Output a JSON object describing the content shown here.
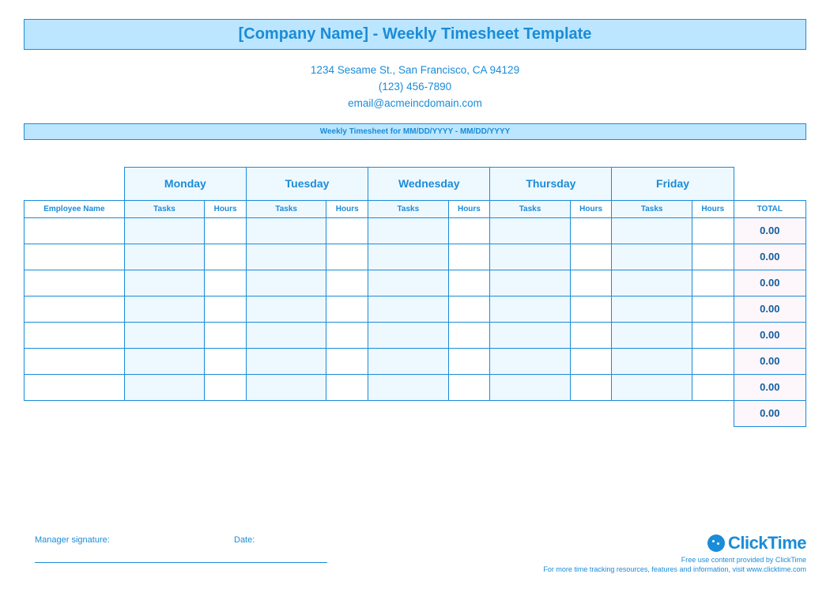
{
  "title": "[Company Name] - Weekly Timesheet Template",
  "company": {
    "address": "1234 Sesame St.,  San Francisco, CA 94129",
    "phone": "(123) 456-7890",
    "email": "email@acmeincdomain.com"
  },
  "week_label": "Weekly Timesheet for MM/DD/YYYY - MM/DD/YYYY",
  "columns": {
    "employee": "Employee Name",
    "days": [
      "Monday",
      "Tuesday",
      "Wednesday",
      "Thursday",
      "Friday"
    ],
    "tasks": "Tasks",
    "hours": "Hours",
    "total": "TOTAL"
  },
  "rows": [
    {
      "name": "",
      "cells": [
        "",
        "",
        "",
        "",
        "",
        "",
        "",
        "",
        "",
        ""
      ],
      "total": "0.00"
    },
    {
      "name": "",
      "cells": [
        "",
        "",
        "",
        "",
        "",
        "",
        "",
        "",
        "",
        ""
      ],
      "total": "0.00"
    },
    {
      "name": "",
      "cells": [
        "",
        "",
        "",
        "",
        "",
        "",
        "",
        "",
        "",
        ""
      ],
      "total": "0.00"
    },
    {
      "name": "",
      "cells": [
        "",
        "",
        "",
        "",
        "",
        "",
        "",
        "",
        "",
        ""
      ],
      "total": "0.00"
    },
    {
      "name": "",
      "cells": [
        "",
        "",
        "",
        "",
        "",
        "",
        "",
        "",
        "",
        ""
      ],
      "total": "0.00"
    },
    {
      "name": "",
      "cells": [
        "",
        "",
        "",
        "",
        "",
        "",
        "",
        "",
        "",
        ""
      ],
      "total": "0.00"
    },
    {
      "name": "",
      "cells": [
        "",
        "",
        "",
        "",
        "",
        "",
        "",
        "",
        "",
        ""
      ],
      "total": "0.00"
    }
  ],
  "grand_total": "0.00",
  "signature": {
    "manager_label": "Manager signature:",
    "date_label": "Date:"
  },
  "brand": {
    "name": "ClickTime",
    "line1": "Free use content provided by ClickTime",
    "line2": "For more time tracking resources, features and information, visit www.clicktime.com"
  }
}
